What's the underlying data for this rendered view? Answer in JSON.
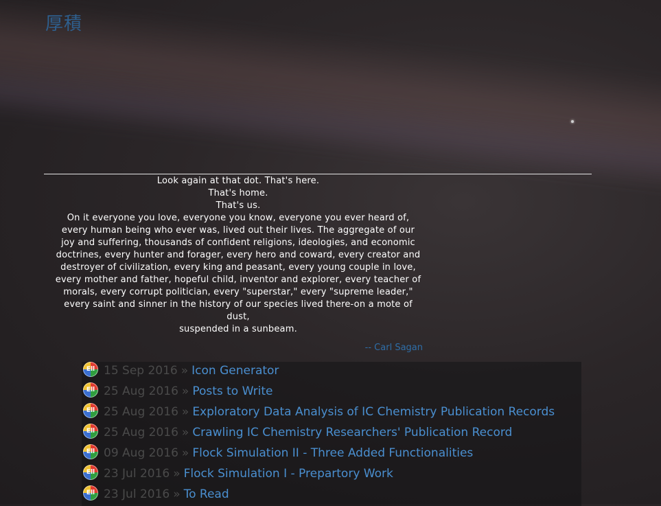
{
  "header": {
    "site_title": "厚積"
  },
  "quote": {
    "lines": [
      "Look again at that dot. That's here.",
      "That's home.",
      "That's us.",
      "On it everyone you love, everyone you know, everyone you ever heard of,",
      "every human being who ever was, lived out their lives. The aggregate of our",
      "joy and suffering, thousands of confident religions, ideologies, and economic",
      "doctrines, every hunter and forager, every hero and coward, every creator and",
      "destroyer of civilization, every king and peasant, every young couple in love,",
      "every mother and father, hopeful child, inventor and explorer, every teacher of",
      "morals, every corrupt politician, every \"superstar,\" every \"supreme leader,\"",
      "every saint and sinner in the history of our species lived there-on a mote of",
      "dust,",
      "suspended in a sunbeam."
    ],
    "attribution": "-- Carl Sagan"
  },
  "posts": {
    "separator": "»",
    "icon_label": "Ell",
    "items": [
      {
        "date": "15 Sep 2016",
        "title": "Icon Generator"
      },
      {
        "date": "25 Aug 2016",
        "title": "Posts to Write"
      },
      {
        "date": "25 Aug 2016",
        "title": "Exploratory Data Analysis of IC Chemistry Publication Records"
      },
      {
        "date": "25 Aug 2016",
        "title": "Crawling IC Chemistry Researchers' Publication Record"
      },
      {
        "date": "09 Aug 2016",
        "title": "Flock Simulation II - Three Added Functionalities"
      },
      {
        "date": "23 Jul 2016",
        "title": "Flock Simulation I - Prepartory Work"
      },
      {
        "date": "23 Jul 2016",
        "title": "To Read"
      }
    ]
  }
}
